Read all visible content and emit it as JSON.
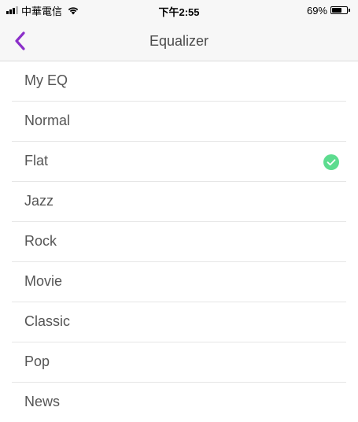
{
  "status_bar": {
    "carrier": "中華電信",
    "time": "下午2:55",
    "battery_percent": "69%",
    "battery_level": 0.69,
    "signal_bars": 3,
    "icons": [
      "signal-icon",
      "wifi-icon",
      "battery-icon"
    ]
  },
  "nav": {
    "title": "Equalizer",
    "back_icon": "chevron-left-icon"
  },
  "colors": {
    "accent": "#8b2fc9",
    "check": "#5ddc8f",
    "label_text": "#555555",
    "title_text": "#4a4a4a"
  },
  "eq_options": [
    {
      "label": "My EQ",
      "selected": false
    },
    {
      "label": "Normal",
      "selected": false
    },
    {
      "label": "Flat",
      "selected": true
    },
    {
      "label": "Jazz",
      "selected": false
    },
    {
      "label": "Rock",
      "selected": false
    },
    {
      "label": "Movie",
      "selected": false
    },
    {
      "label": "Classic",
      "selected": false
    },
    {
      "label": "Pop",
      "selected": false
    },
    {
      "label": "News",
      "selected": false
    }
  ]
}
